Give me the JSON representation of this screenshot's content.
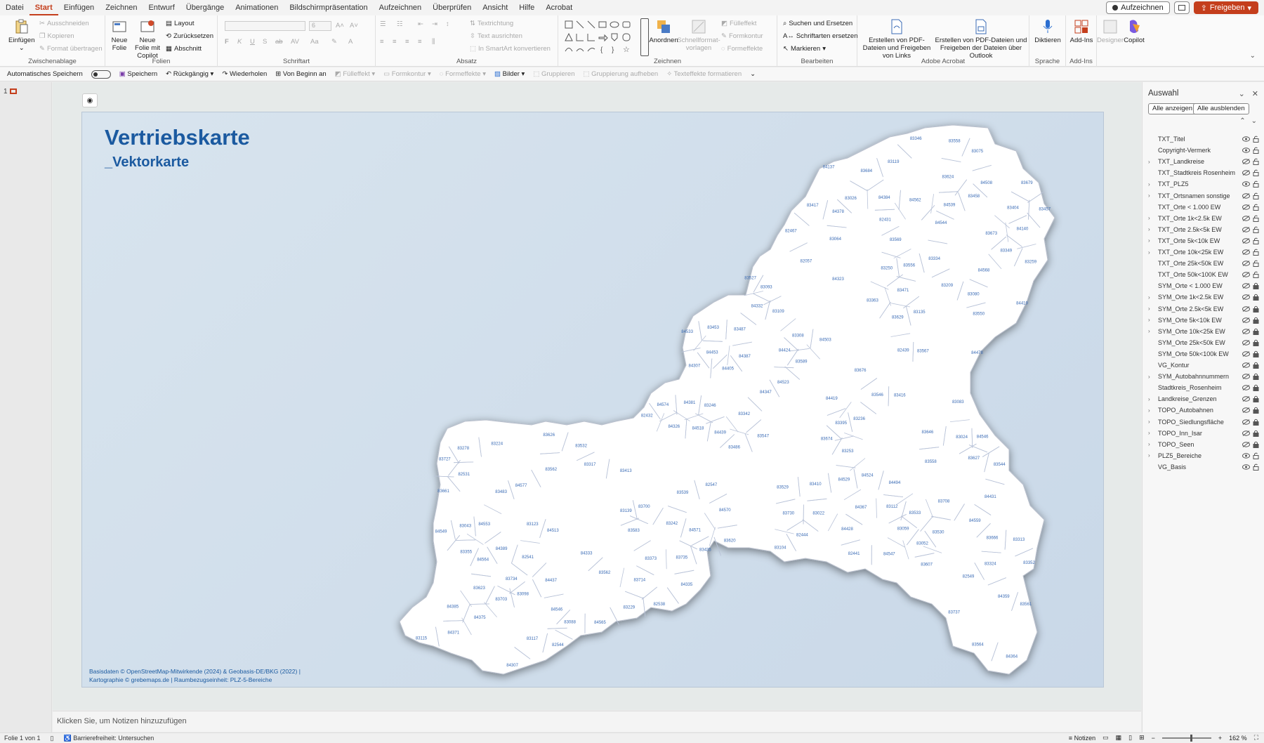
{
  "menu_tabs": [
    "Datei",
    "Start",
    "Einfügen",
    "Zeichnen",
    "Entwurf",
    "Übergänge",
    "Animationen",
    "Bildschirmpräsentation",
    "Aufzeichnen",
    "Überprüfen",
    "Ansicht",
    "Hilfe",
    "Acrobat"
  ],
  "active_tab_index": 1,
  "topbar_right": {
    "record": "Aufzeichnen",
    "share": "Freigeben"
  },
  "ribbon": {
    "clipboard": {
      "paste": "Einfügen",
      "cut": "Ausschneiden",
      "copy": "Kopieren",
      "format_painter": "Format übertragen",
      "label": "Zwischenablage"
    },
    "slides": {
      "new_slide": "Neue Folie",
      "new_slide_copilot": "Neue Folie mit Copilot",
      "layout": "Layout",
      "reset": "Zurücksetzen",
      "section": "Abschnitt",
      "label": "Folien"
    },
    "font": {
      "label": "Schriftart",
      "size": "6"
    },
    "paragraph": {
      "text_direction": "Textrichtung",
      "align_text": "Text ausrichten",
      "smartart": "In SmartArt konvertieren",
      "label": "Absatz"
    },
    "drawing": {
      "arrange": "Anordnen",
      "quick_styles": "Schnellformat-vorlagen",
      "fill": "Fülleffekt",
      "outline": "Formkontur",
      "effects": "Formeffekte",
      "label": "Zeichnen"
    },
    "editing": {
      "find": "Suchen und Ersetzen",
      "replace_fonts": "Schriftarten ersetzen",
      "select": "Markieren",
      "label": "Bearbeiten"
    },
    "acrobat": {
      "create_links": "Erstellen von PDF-Dateien und Freigeben von Links",
      "create_outlook": "Erstellen von PDF-Dateien und Freigeben der Dateien über Outlook",
      "label": "Adobe Acrobat"
    },
    "voice": {
      "dictate": "Diktieren",
      "label": "Sprache"
    },
    "addins": {
      "addins": "Add-Ins",
      "label": "Add-Ins"
    },
    "designer": "Designer",
    "copilot": "Copilot"
  },
  "qat": {
    "autosave": "Automatisches Speichern",
    "save": "Speichern",
    "undo": "Rückgängig",
    "redo": "Wiederholen",
    "from_start": "Von Beginn an",
    "fill": "Fülleffekt",
    "outline": "Formkontur",
    "effects": "Formeffekte",
    "pictures": "Bilder",
    "group": "Gruppieren",
    "ungroup": "Gruppierung aufheben",
    "text_effects": "Texteffekte formatieren"
  },
  "slide": {
    "number": "1",
    "title": "Vertriebskarte",
    "subtitle": "_Vektorkarte",
    "footer_line1": "Basisdaten © OpenStreetMap-Mitwirkende (2024)  & Geobasis-DE/BKG (2022)  |",
    "footer_line2": "Kartographie © grebemaps.de  |  Raumbezugseinheit: PLZ-5-Bereiche",
    "plz_labels": [
      "84439",
      "84381",
      "84385",
      "84424",
      "84333",
      "84137",
      "84378",
      "84347",
      "84364",
      "84140",
      "84326",
      "84323",
      "84307",
      "84332",
      "84389",
      "84371",
      "84546",
      "84494",
      "84529",
      "84419",
      "84335",
      "84307",
      "84384",
      "84359",
      "84428",
      "84523",
      "84564",
      "84568",
      "84367",
      "84437",
      "84539",
      "84562",
      "84453",
      "84571",
      "84524",
      "84533",
      "84387",
      "84375",
      "84419",
      "84431",
      "84478",
      "84570",
      "84503",
      "84547",
      "84405",
      "84559",
      "84577",
      "84513",
      "84565",
      "84544",
      "84546",
      "84574",
      "84549",
      "84518",
      "84508",
      "84553",
      "83558",
      "83527",
      "83546",
      "83562",
      "83564",
      "83567",
      "83544",
      "83533",
      "83532",
      "83547",
      "83530",
      "83342",
      "83308",
      "83550",
      "83558",
      "83529",
      "83539",
      "83561",
      "83562",
      "83583",
      "83556",
      "83589",
      "83123",
      "83119",
      "83363",
      "83352",
      "83349",
      "83373",
      "83413",
      "82057",
      "82544",
      "83624",
      "83626",
      "83620",
      "83104",
      "83135",
      "83569",
      "83139",
      "83093",
      "83253",
      "83278",
      "83417",
      "83410",
      "82541",
      "82538",
      "82531",
      "83623",
      "83607",
      "83629",
      "83052",
      "83043",
      "83109",
      "83024",
      "83022",
      "83059",
      "83026",
      "83083",
      "83209",
      "83236",
      "83355",
      "83346",
      "83313",
      "83317",
      "83416",
      "83395",
      "82547",
      "82549",
      "83627",
      "83737",
      "83075",
      "83064",
      "83115",
      "83112",
      "83229",
      "83250",
      "83224",
      "83324",
      "83334",
      "83404",
      "83646",
      "83679",
      "83666",
      "83673",
      "83714",
      "83734",
      "83730",
      "83098",
      "83117",
      "83259",
      "83246",
      "83458",
      "83453",
      "83435",
      "82439",
      "82431",
      "82444",
      "83674",
      "83727",
      "83703",
      "83684",
      "83676",
      "83661",
      "83708",
      "83700",
      "83735",
      "83080",
      "83088",
      "83242",
      "83483",
      "83486",
      "83471",
      "83487",
      "83457",
      "82441",
      "82432",
      "82467"
    ]
  },
  "notes_placeholder": "Klicken Sie, um Notizen hinzuzufügen",
  "pane": {
    "title": "Auswahl",
    "show_all": "Alle anzeigen",
    "hide_all": "Alle ausblenden",
    "layers": [
      {
        "name": "TXT_Titel",
        "exp": false,
        "visible": true,
        "locked": false
      },
      {
        "name": "Copyright-Vermerk",
        "exp": false,
        "visible": true,
        "locked": false
      },
      {
        "name": "TXT_Landkreise",
        "exp": true,
        "visible": false,
        "locked": false
      },
      {
        "name": "TXT_Stadtkreis Rosenheim",
        "exp": false,
        "visible": false,
        "locked": false
      },
      {
        "name": "TXT_PLZ5",
        "exp": true,
        "visible": true,
        "locked": false
      },
      {
        "name": "TXT_Ortsnamen sonstige",
        "exp": true,
        "visible": false,
        "locked": false
      },
      {
        "name": "TXT_Orte < 1.000 EW",
        "exp": false,
        "visible": false,
        "locked": false
      },
      {
        "name": "TXT_Orte 1k<2.5k EW",
        "exp": true,
        "visible": false,
        "locked": false
      },
      {
        "name": "TXT_Orte 2.5k<5k EW",
        "exp": true,
        "visible": false,
        "locked": false
      },
      {
        "name": "TXT_Orte 5k<10k EW",
        "exp": true,
        "visible": false,
        "locked": false
      },
      {
        "name": "TXT_Orte 10k<25k EW",
        "exp": true,
        "visible": false,
        "locked": false
      },
      {
        "name": "TXT_Orte 25k<50k EW",
        "exp": false,
        "visible": false,
        "locked": false
      },
      {
        "name": "TXT_Orte 50k<100K EW",
        "exp": false,
        "visible": false,
        "locked": false
      },
      {
        "name": "SYM_Orte < 1.000 EW",
        "exp": false,
        "visible": false,
        "locked": true
      },
      {
        "name": "SYM_Orte 1k<2.5k EW",
        "exp": true,
        "visible": false,
        "locked": true
      },
      {
        "name": "SYM_Orte 2.5k<5k EW",
        "exp": true,
        "visible": false,
        "locked": true
      },
      {
        "name": "SYM_Orte 5k<10k EW",
        "exp": true,
        "visible": false,
        "locked": true
      },
      {
        "name": "SYM_Orte 10k<25k EW",
        "exp": true,
        "visible": false,
        "locked": true
      },
      {
        "name": "SYM_Orte 25k<50k EW",
        "exp": false,
        "visible": false,
        "locked": true
      },
      {
        "name": "SYM_Orte 50k<100k EW",
        "exp": false,
        "visible": false,
        "locked": true
      },
      {
        "name": "VG_Kontur",
        "exp": false,
        "visible": false,
        "locked": true
      },
      {
        "name": "SYM_Autobahnnummern",
        "exp": true,
        "visible": false,
        "locked": true
      },
      {
        "name": "Stadtkreis_Rosenheim",
        "exp": false,
        "visible": false,
        "locked": true
      },
      {
        "name": "Landkreise_Grenzen",
        "exp": true,
        "visible": false,
        "locked": true
      },
      {
        "name": "TOPO_Autobahnen",
        "exp": true,
        "visible": false,
        "locked": true
      },
      {
        "name": "TOPO_Siedlungsfläche",
        "exp": true,
        "visible": false,
        "locked": true
      },
      {
        "name": "TOPO_Inn_Isar",
        "exp": true,
        "visible": false,
        "locked": true
      },
      {
        "name": "TOPO_Seen",
        "exp": true,
        "visible": false,
        "locked": true
      },
      {
        "name": "PLZ5_Bereiche",
        "exp": true,
        "visible": true,
        "locked": false
      },
      {
        "name": "VG_Basis",
        "exp": false,
        "visible": true,
        "locked": false
      }
    ]
  },
  "status": {
    "slide_of": "Folie 1 von 1",
    "accessibility": "Barrierefreiheit: Untersuchen",
    "notes": "Notizen",
    "zoom": "162 %"
  },
  "colors": {
    "accent": "#c43e1c",
    "title_blue": "#1b5aa0",
    "plz_blue": "#3a6bb5"
  }
}
